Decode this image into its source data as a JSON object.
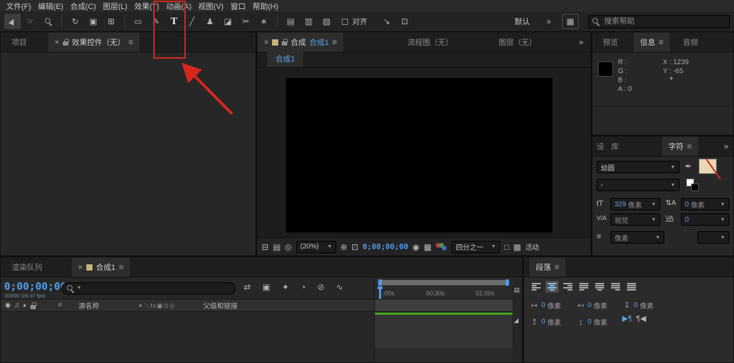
{
  "menubar": {
    "items": [
      "文件(F)",
      "编辑(E)",
      "合成(C)",
      "图层(L)",
      "效果(T)",
      "动画(A)",
      "视图(V)",
      "窗口",
      "帮助(H)"
    ]
  },
  "toolbar": {
    "align_label": "对齐",
    "workspace_label": "默认",
    "search_placeholder": "搜索帮助"
  },
  "left_panel": {
    "project_tab": "项目",
    "effect_controls_tab": "效果控件（无）"
  },
  "comp_panel": {
    "viewer_tab_prefix": "合成",
    "viewer_tab_name": "合成1",
    "flowchart_tab": "流程图（无）",
    "layer_tab": "图层（无）",
    "subtab": "合成1",
    "zoom_value": "(20%)",
    "timecode": "0;00;00;00",
    "resolution": "四分之一",
    "camera_label": "活动"
  },
  "info_panel": {
    "preview_tab": "预览",
    "info_tab": "信息",
    "audio_tab": "音频",
    "r_label": "R :",
    "g_label": "G :",
    "b_label": "B :",
    "a_label": "A : 0",
    "x_label": "X : 1239",
    "y_label": "Y : -65",
    "plus": "+"
  },
  "char_panel": {
    "presets_tab": "设",
    "library_tab": "库",
    "character_tab": "字符",
    "font_family": "幼圆",
    "font_style": "-",
    "size_value": "329",
    "size_unit": "像素",
    "leading_value": "0",
    "leading_unit": "像素",
    "kerning_value": "视觉",
    "tracking_value": "0",
    "baseline_unit": "像素"
  },
  "timeline_panel": {
    "render_queue_tab": "渲染队列",
    "comp_tab": "合成1",
    "timecode": "0;00;00;00",
    "frames_label": "00000 (29.97 fps)",
    "hash_col": "#",
    "source_col": "源名称",
    "switches_col": "✦＼fx▣⊙◎",
    "parent_col": "父级和链接",
    "ruler": [
      ":00s",
      "00:30s",
      "01:00s"
    ]
  },
  "paragraph_panel": {
    "tab": "段落",
    "fields": [
      {
        "v": "0",
        "u": "像素"
      },
      {
        "v": "0",
        "u": "像素"
      },
      {
        "v": "0",
        "u": "像素"
      },
      {
        "v": "0",
        "u": "像素"
      },
      {
        "v": "0",
        "u": "像素"
      }
    ]
  }
}
